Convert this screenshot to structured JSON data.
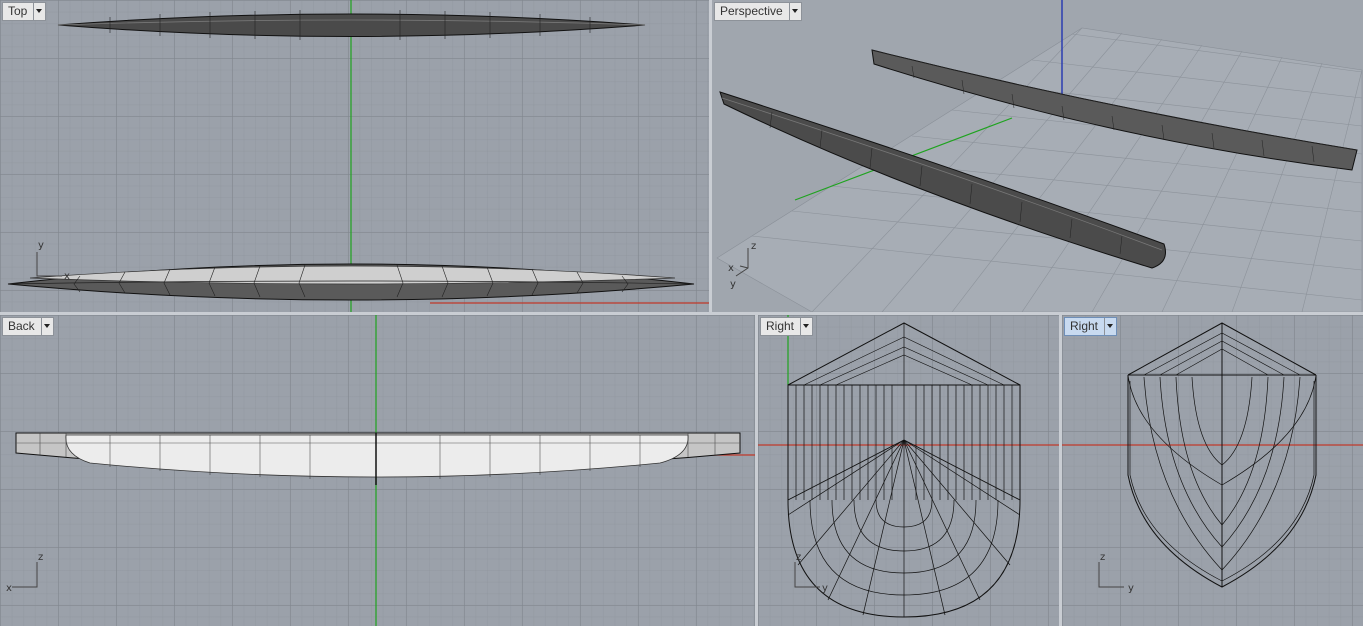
{
  "viewports": {
    "top": {
      "label": "Top",
      "axis_a": "y",
      "axis_b": "x"
    },
    "perspective": {
      "label": "Perspective",
      "axis_z": "z",
      "axis_x": "x",
      "axis_y": "y"
    },
    "back": {
      "label": "Back",
      "axis_a": "z",
      "axis_b": "x"
    },
    "right1": {
      "label": "Right",
      "axis_a": "z",
      "axis_b": "y"
    },
    "right2": {
      "label": "Right",
      "axis_a": "z",
      "axis_b": "y"
    }
  },
  "colors": {
    "background": "#9ba1aa",
    "x_axis": "#c0392b",
    "y_axis": "#1fa31f",
    "z_axis": "#2b3db0",
    "hull_dark": "#3c3c3c",
    "hull_light": "#d7d7d7",
    "active_label": "#c8daf0"
  },
  "icons": {
    "viewport_menu": "chevron-down-icon"
  }
}
